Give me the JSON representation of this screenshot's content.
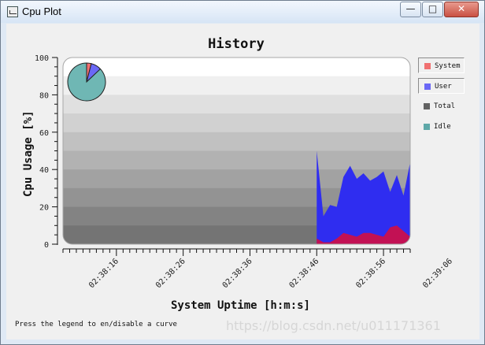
{
  "window": {
    "title": "Cpu Plot",
    "minimize_symbol": "—",
    "maximize_symbol": "□",
    "close_symbol": "✕"
  },
  "chart_data": {
    "type": "area",
    "title": "History",
    "xlabel": "System Uptime [h:m:s]",
    "ylabel": "Cpu Usage [%]",
    "ylim": [
      0,
      100
    ],
    "y_ticks": [
      0,
      20,
      40,
      60,
      80,
      100
    ],
    "x_ticks": [
      "02:38:16",
      "02:38:26",
      "02:38:36",
      "02:38:46",
      "02:38:56",
      "02:39:06"
    ],
    "x_range_seconds": [
      8,
      60
    ],
    "series": [
      {
        "name": "System",
        "x": [
          46,
          47,
          48,
          49,
          50,
          51,
          52,
          53,
          54,
          55,
          56,
          57,
          58,
          59,
          60
        ],
        "values": [
          3,
          1,
          1,
          3,
          6,
          5,
          4,
          6,
          6,
          5,
          4,
          9,
          10,
          7,
          4
        ]
      },
      {
        "name": "User",
        "x": [
          46,
          47,
          48,
          49,
          50,
          51,
          52,
          53,
          54,
          55,
          56,
          57,
          58,
          59,
          60
        ],
        "values": [
          50,
          15,
          21,
          20,
          36,
          42,
          35,
          38,
          34,
          36,
          39,
          28,
          37,
          26,
          44
        ]
      }
    ],
    "legend": [
      {
        "name": "System",
        "color": "#f07070",
        "selected": true
      },
      {
        "name": "User",
        "color": "#6b68f6",
        "selected": true
      },
      {
        "name": "Total",
        "color": "#626262",
        "selected": false
      },
      {
        "name": "Idle",
        "color": "#5ea8a8",
        "selected": false
      }
    ],
    "pie": {
      "slices": [
        {
          "name": "System",
          "value": 4,
          "color": "#f07070"
        },
        {
          "name": "User",
          "value": 9,
          "color": "#6b68f6"
        },
        {
          "name": "Idle",
          "value": 87,
          "color": "#6fb7b4"
        }
      ]
    },
    "hint": "Press the legend to en/disable a curve"
  },
  "watermark": "https://blog.csdn.net/u011171361"
}
